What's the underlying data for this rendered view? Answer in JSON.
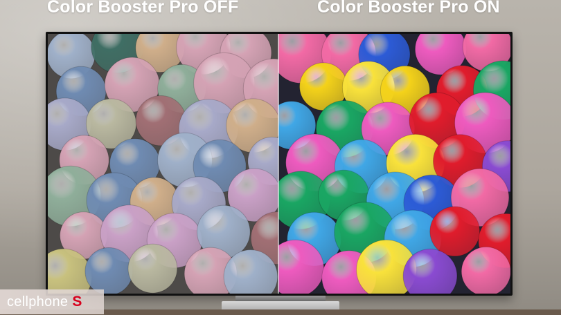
{
  "captions": {
    "off": "Color Booster Pro OFF",
    "on": "Color Booster Pro ON"
  },
  "watermark": {
    "text": "cellphone",
    "mark": "S"
  },
  "colors": {
    "off_palette": [
      "#c9a0c6",
      "#8fae9a",
      "#b9b8a0",
      "#d4a2b4",
      "#9fb0c9",
      "#3f6e64",
      "#c8c17e",
      "#a16f74",
      "#a7a9c8",
      "#6f8bb2",
      "#cfae8a"
    ],
    "on_palette": [
      "#2c5bd6",
      "#e01c2c",
      "#f4d21a",
      "#f26aa5",
      "#1aa663",
      "#8a4bd1",
      "#40a7e6",
      "#f07a22",
      "#ee5bbf",
      "#24a07a",
      "#f9e23b"
    ]
  }
}
